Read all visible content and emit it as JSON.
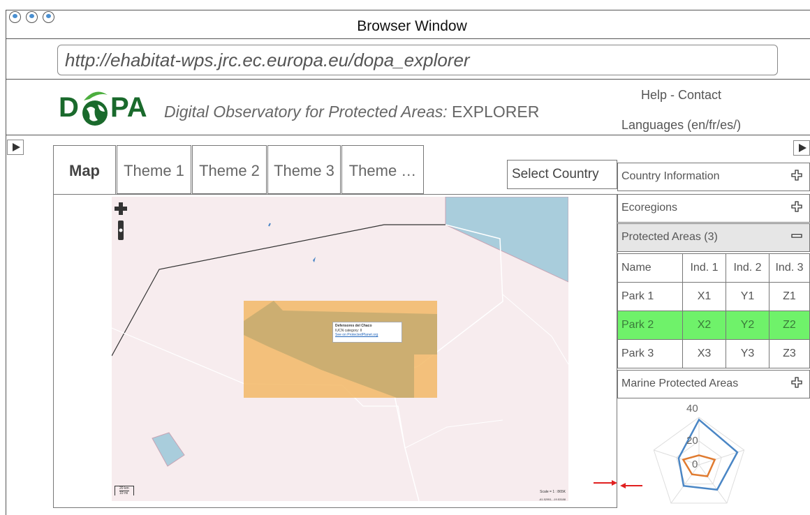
{
  "window": {
    "title": "Browser Window",
    "url": "http://ehabitat-wps.jrc.ec.europa.eu/dopa_explorer"
  },
  "header": {
    "logo_left": "D",
    "logo_right": "PA",
    "subtitle_italic": "Digital Observatory for Protected Areas:",
    "subtitle_plain": " EXPLORER",
    "help": "Help - Contact",
    "languages": "Languages  (en/fr/es/)"
  },
  "tabs": [
    "Map",
    "Theme 1",
    "Theme 2",
    "Theme 3",
    "Theme …"
  ],
  "select_country": "Select Country",
  "map": {
    "popup": {
      "title": "Defensores del Chaco",
      "category": "IUCN category: II",
      "link": "See on ProtectedPlanet.org"
    },
    "scale_bar": {
      "km": "20 km",
      "mi": "10 mi"
    },
    "scale": "Scale = 1 : 865K",
    "coords": "-61.52951, -19.53188"
  },
  "panel": {
    "country_info": "Country Information",
    "ecoregions": "Ecoregions",
    "protected_areas": "Protected Areas (3)",
    "marine": "Marine Protected Areas",
    "table": {
      "headers": [
        "Name",
        "Ind. 1",
        "Ind. 2",
        "Ind. 3"
      ],
      "rows": [
        [
          "Park 1",
          "X1",
          "Y1",
          "Z1"
        ],
        [
          "Park 2",
          "X2",
          "Y2",
          "Z2"
        ],
        [
          "Park 3",
          "X3",
          "Y3",
          "Z3"
        ]
      ],
      "highlight_row": 1,
      "highlight_color": "#6ff26a"
    }
  },
  "chart_data": {
    "type": "radar",
    "tick_labels": [
      "40",
      "20",
      "0"
    ],
    "series": [
      {
        "color": "#4a86c5",
        "values": [
          38,
          34,
          26,
          22,
          18
        ]
      },
      {
        "color": "#e07b30",
        "values": [
          8,
          14,
          12,
          10,
          14
        ]
      }
    ]
  },
  "colors": {
    "accent_arrow": "#e02020",
    "protected_area": "#f2b866",
    "water": "#a9cddc"
  }
}
